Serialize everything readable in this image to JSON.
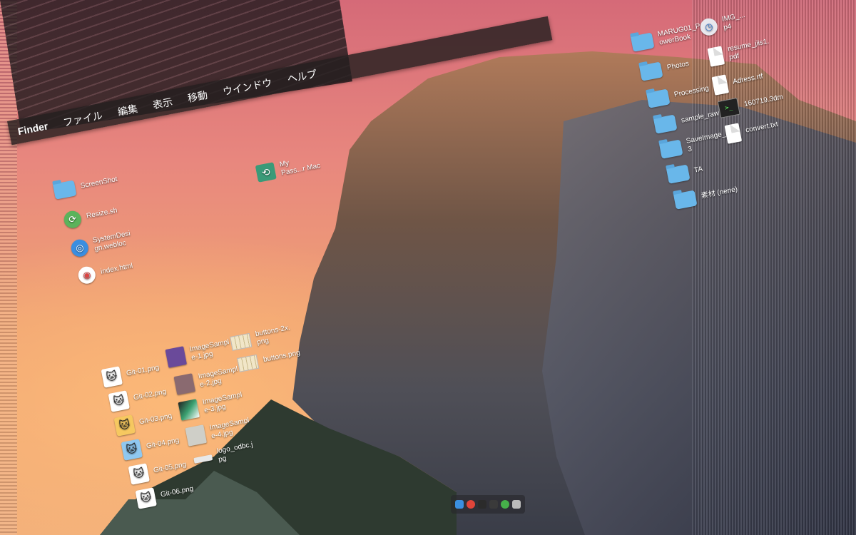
{
  "menu": {
    "app": "Finder",
    "items": [
      "ファイル",
      "編集",
      "表示",
      "移動",
      "ウインドウ",
      "ヘルプ"
    ]
  },
  "desktop": {
    "left_icons": [
      {
        "label": "ScreenShot",
        "icon": "folder-icon"
      },
      {
        "label": "Resize.sh",
        "icon": "script-icon"
      },
      {
        "label": "SystemDesi\ngn.webloc",
        "icon": "safari-icon"
      },
      {
        "label": "index.html",
        "icon": "chrome-icon"
      }
    ],
    "center_icon": {
      "label": "My\nPass...r Mac",
      "icon": "time-machine-icon"
    },
    "right_icons": [
      {
        "label": "MARUG01_P\nowerBook",
        "icon": "folder-icon"
      },
      {
        "label": "IMG_...\np4",
        "icon": "quicktime-icon"
      },
      {
        "label": "resume_jiis1.\npdf",
        "icon": "pdf-icon"
      },
      {
        "label": "Photos",
        "icon": "folder-icon"
      },
      {
        "label": "Adress.rtf",
        "icon": "document-icon"
      },
      {
        "label": "Processing",
        "icon": "folder-icon"
      },
      {
        "label": "160719.3dm",
        "icon": "terminal-icon"
      },
      {
        "label": "sample_raw",
        "icon": "folder-icon"
      },
      {
        "label": "convert.txt",
        "icon": "text-file-icon"
      },
      {
        "label": "SaveImage_\n3",
        "icon": "folder-icon"
      },
      {
        "label": "TA",
        "icon": "folder-icon"
      },
      {
        "label": "素材 (nene)",
        "icon": "folder-icon"
      }
    ],
    "git_icons": [
      "Git-01.png",
      "Git-02.png",
      "Git-03.png",
      "Git-04.png",
      "Git-05.png",
      "Git-06.png"
    ],
    "image_icons": [
      {
        "label": "ImageSampl\ne-1.jpg",
        "color": "#6a4a9a"
      },
      {
        "label": "ImageSampl\ne-2.jpg",
        "color": "#8a6a70"
      },
      {
        "label": "ImageSampl\ne-3.jpg",
        "color": "#3aa070"
      },
      {
        "label": "ImageSampl\ne-4.jpg",
        "color": "#cfcfc8"
      },
      {
        "label": "logo_odbc.j\npg",
        "color": "#e8e8e8"
      }
    ],
    "button_icons": [
      {
        "label": "buttons-2x.\npng"
      },
      {
        "label": "buttons.png"
      }
    ]
  },
  "dock": {
    "items": [
      {
        "name": "finder-icon",
        "color": "#3b8fe0"
      },
      {
        "name": "chrome-icon",
        "color": "#e0453a"
      },
      {
        "name": "terminal-icon",
        "color": "#2b2b2b"
      },
      {
        "name": "activity-icon",
        "color": "#3a3a3a"
      },
      {
        "name": "app-icon",
        "color": "#46b04a"
      },
      {
        "name": "trash-icon",
        "color": "#bbbbbb"
      }
    ]
  }
}
